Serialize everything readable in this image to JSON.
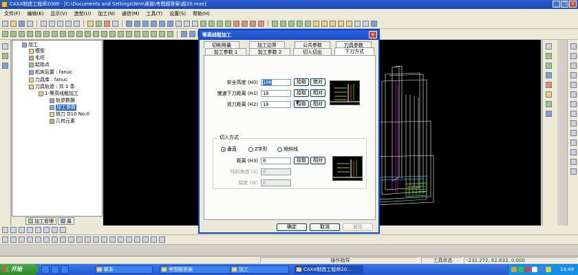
{
  "window": {
    "title": "CAXA制造工程师2008  - [C:\\Documents and Settings\\Wm\\桌面\\考图题答案\\题20.mxe]"
  },
  "menu": [
    "文件(F)",
    "编辑(E)",
    "显示(V)",
    "造型(U)",
    "加工(N)",
    "通信(M)",
    "工具(T)",
    "设置(S)",
    "帮助(H)"
  ],
  "tree": {
    "root": "加工",
    "model": "模型",
    "blank": "毛坯",
    "start_point": "起始点",
    "post": "机床后置 : fanuc",
    "tool_lib": "刀具库 : fanuc",
    "toolpaths": "刀具轨迹 : 共 1 条",
    "op": "1-等高线粗加工",
    "track_data": "轨迹数据",
    "params": "加工参数",
    "tool": "铣刀 D10 No:0",
    "geometry": "几何元素",
    "tabs": [
      "加工管理",
      "属"
    ]
  },
  "dialog": {
    "title": "等高线粗加工",
    "tabs_row1": [
      "切削用量",
      "加工边界",
      "公共参数",
      "刀具参数"
    ],
    "tabs_row2": [
      "加工参数 1",
      "加工参数 2",
      "切入切出",
      "下刀方式"
    ],
    "fields": {
      "safe_height": {
        "label": "安全高度 (H0)",
        "value": "100"
      },
      "slow_feed": {
        "label": "慢速下刀距离 (H1)",
        "value": "10"
      },
      "retract": {
        "label": "退刀距离 (H2)",
        "value": "10"
      }
    },
    "pick_label": "拾取",
    "absolute_label": "绝对",
    "relative_label": "相对",
    "cut_in": {
      "group": "切入方式",
      "options": [
        "垂直",
        "Z字形",
        "倾斜线"
      ],
      "selected": "垂直",
      "distance": {
        "label": "距离 (H3)",
        "value": "0"
      },
      "angle": {
        "label": "倾斜角度 (A)",
        "value": "0"
      },
      "width": {
        "label": "幅度 (W)",
        "value": "0"
      }
    },
    "buttons": {
      "ok": "确定",
      "cancel": "取消",
      "help": "悬挂"
    }
  },
  "status": {
    "prompt": "操作指导",
    "state": "工具状态",
    "coords": "-232.272, 62.833, 0.000"
  },
  "taskbar": {
    "start": "开始",
    "tasks": [
      "联系",
      "考图题答案",
      "加工",
      "CAXA制造工程师20..."
    ],
    "clock": "13:49"
  },
  "colors": {
    "title_blue": "#1c47b4",
    "select_blue": "#316ac5",
    "viewport": "#000000"
  }
}
